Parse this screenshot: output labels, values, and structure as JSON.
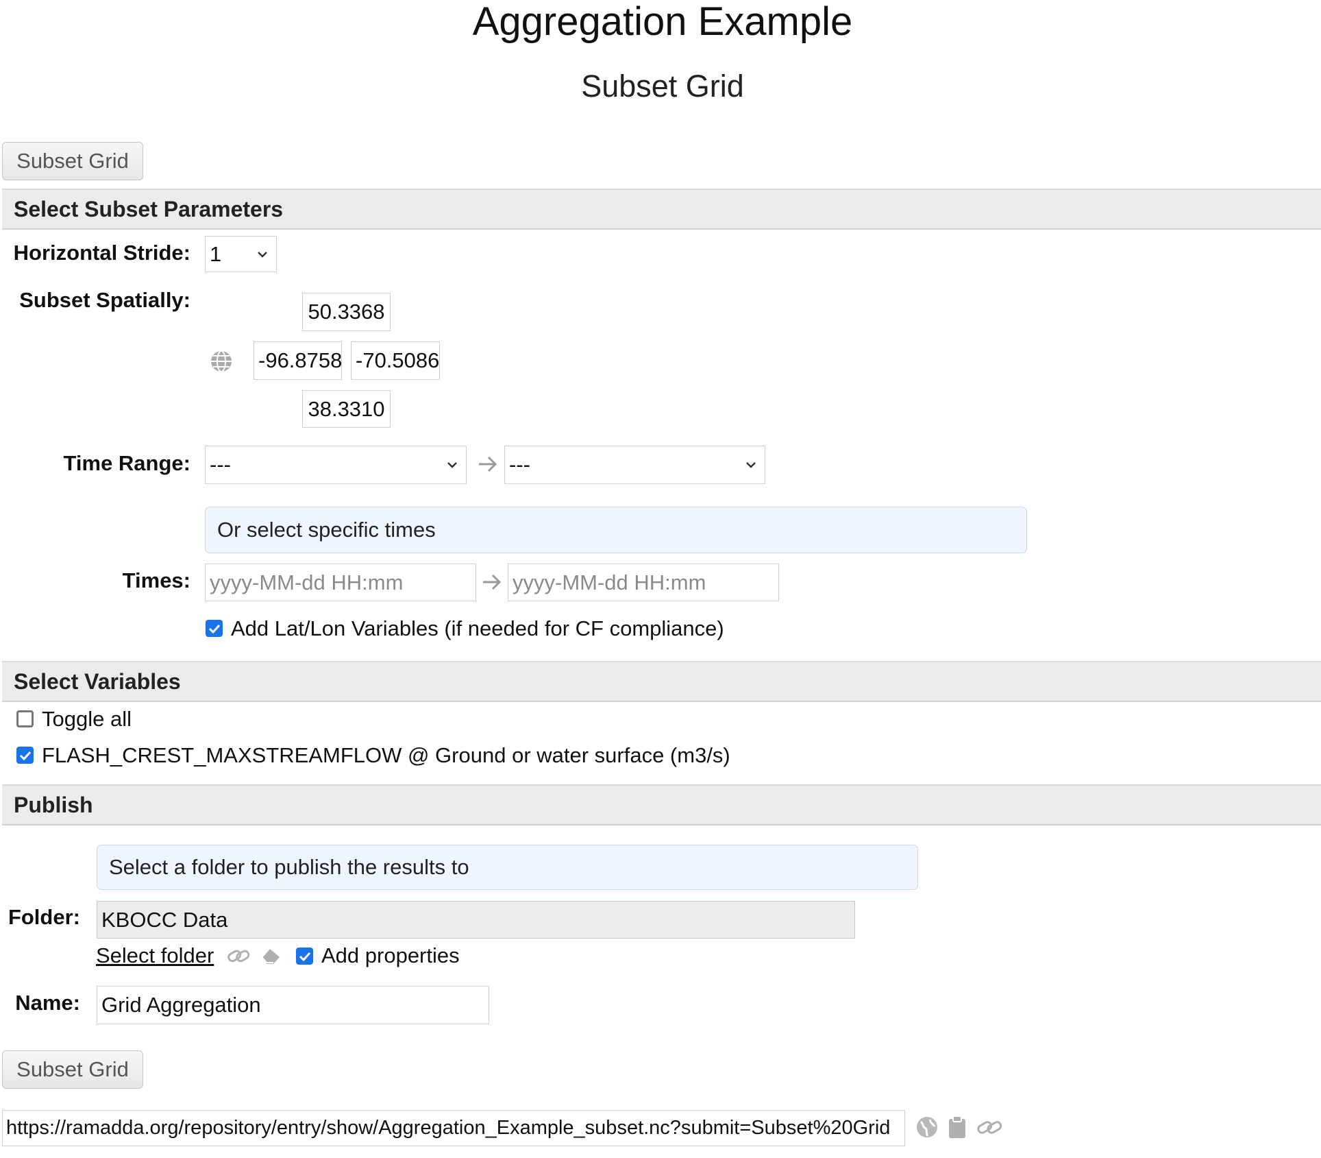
{
  "page": {
    "title": "Aggregation Example",
    "subtitle": "Subset Grid"
  },
  "top_button": {
    "label": "Subset Grid"
  },
  "subset_section": {
    "header": "Select Subset Parameters",
    "stride_label": "Horizontal Stride:",
    "stride_value": "1",
    "spatial_label": "Subset Spatially:",
    "north": "50.3368",
    "west": "-96.8758",
    "east": "-70.5086",
    "south": "38.3310",
    "time_range_label": "Time Range:",
    "time_start": "---",
    "time_end": "---",
    "specific_times_note": "Or select specific times",
    "times_label": "Times:",
    "time_placeholder_start": "yyyy-MM-dd HH:mm",
    "time_placeholder_end": "yyyy-MM-dd HH:mm",
    "latlon_label": "Add Lat/Lon Variables (if needed for CF compliance)"
  },
  "variables_section": {
    "header": "Select Variables",
    "toggle_all": "Toggle all",
    "variable": "FLASH_CREST_MAXSTREAMFLOW @ Ground or water surface (m3/s)"
  },
  "publish_section": {
    "header": "Publish",
    "note": "Select a folder to publish the results to",
    "folder_label": "Folder:",
    "folder_value": "KBOCC Data",
    "select_folder": "Select folder",
    "add_properties": "Add properties",
    "name_label": "Name:",
    "name_value": "Grid Aggregation"
  },
  "bottom_button": {
    "label": "Subset Grid"
  },
  "url_bar": {
    "value": "https://ramadda.org/repository/entry/show/Aggregation_Example_subset.nc?submit=Subset%20Grid"
  },
  "icons": [
    "globe-icon",
    "chevron-down-icon",
    "arrow-right-icon",
    "link-icon",
    "eraser-icon",
    "clipboard-icon",
    "checkbox-checked-icon"
  ],
  "colors": {
    "checkbox": "#1a73e8",
    "info_bg": "#eef5fe",
    "section_bg": "#ebebeb"
  }
}
